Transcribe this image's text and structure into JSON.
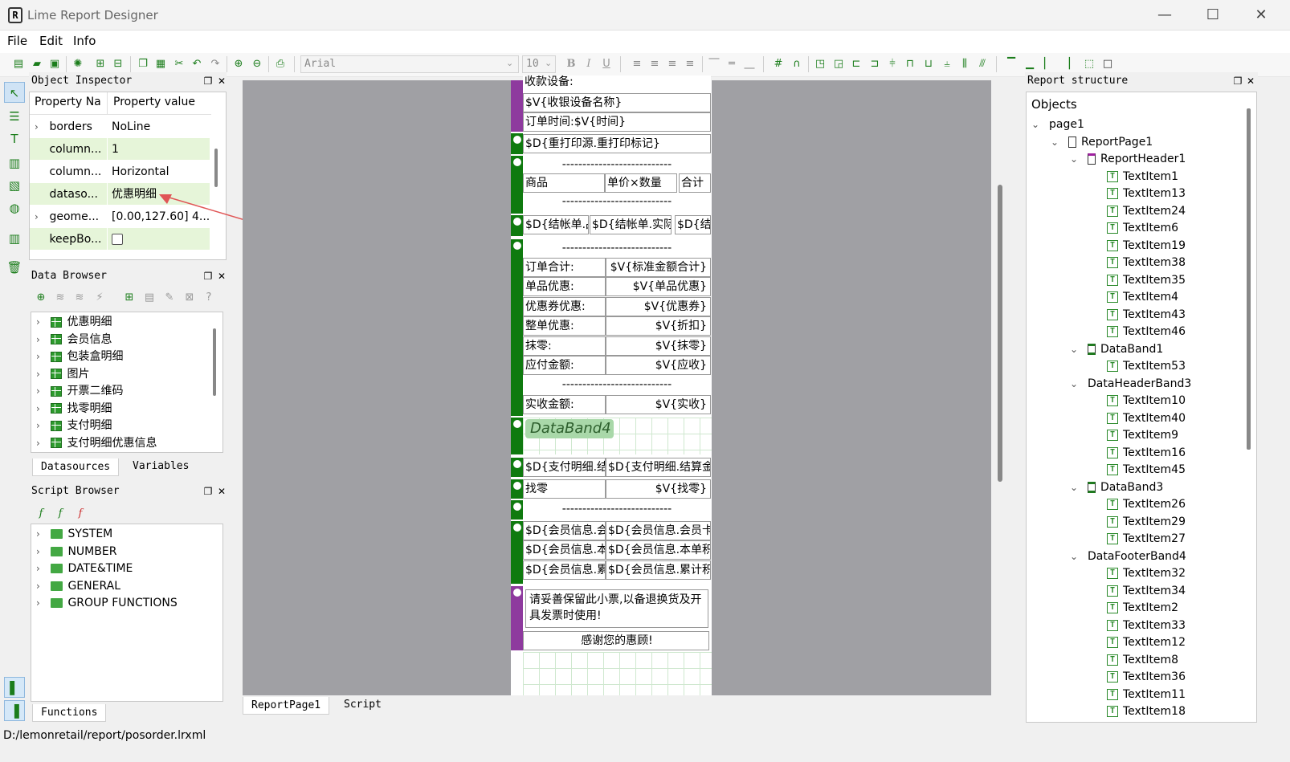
{
  "window": {
    "title": "Lime Report Designer",
    "minimize": "—",
    "maximize": "☐",
    "close": "✕"
  },
  "menu": [
    "File",
    "Edit",
    "Info"
  ],
  "toolbar": {
    "font_name": "Arial",
    "font_size": "10"
  },
  "object_inspector": {
    "title": "Object Inspector",
    "col_name": "Property Na",
    "col_value": "Property value",
    "rows": [
      {
        "name": "borders",
        "value": "NoLine",
        "expand": true,
        "hl": false
      },
      {
        "name": "column...",
        "value": "1",
        "expand": false,
        "hl": true
      },
      {
        "name": "column...",
        "value": "Horizontal",
        "expand": false,
        "hl": false
      },
      {
        "name": "dataso...",
        "value": "优惠明细",
        "expand": false,
        "hl": true
      },
      {
        "name": "geome...",
        "value": "[0.00,127.60] 4...",
        "expand": true,
        "hl": false
      },
      {
        "name": "keepBo...",
        "value": "",
        "expand": false,
        "hl": true,
        "checkbox": true
      }
    ]
  },
  "data_browser": {
    "title": "Data Browser",
    "items": [
      "优惠明细",
      "会员信息",
      "包装盒明细",
      "图片",
      "开票二维码",
      "找零明细",
      "支付明细",
      "支付明细优惠信息"
    ],
    "tabs": [
      "Datasources",
      "Variables"
    ]
  },
  "script_browser": {
    "title": "Script Browser",
    "items": [
      "SYSTEM",
      "NUMBER",
      "DATE&TIME",
      "GENERAL",
      "GROUP FUNCTIONS"
    ],
    "tabs": [
      "Functions"
    ]
  },
  "canvas": {
    "tabs": [
      "ReportPage1",
      "Script"
    ],
    "texts": {
      "t0": "收款设备:",
      "t1": "$V{收银设备名称}",
      "t2": "订单时间:$V{时间}",
      "t3": "$D{重打印源.重打印标记}",
      "t4": "---------------------------",
      "t5": "商品",
      "t6": "单价×数量",
      "t7": "合计",
      "t8": "---------------------------",
      "t9": "$D{结帐单.品名}",
      "t10": "$D{结帐单.实际单价}×",
      "t11": "$D{结帐",
      "t12": "---------------------------",
      "t13": "订单合计:",
      "t14": "$V{标准金额合计}",
      "t15": "单品优惠:",
      "t16": "$V{单品优惠}",
      "t17": "优惠券优惠:",
      "t18": "$V{优惠券}",
      "t19": "整单优惠:",
      "t20": "$V{折扣}",
      "t21": "抹零:",
      "t22": "$V{抹零}",
      "t23": "应付金额:",
      "t24": "$V{应收}",
      "t25": "---------------------------",
      "t26": "实收金额:",
      "t27": "$V{实收}",
      "t28": "DataBand4",
      "t29": "$D{支付明细.结算方",
      "t30": "$D{支付明细.结算金额",
      "t31": "找零",
      "t32": "$V{找零}",
      "t33": "---------------------------",
      "t34": "$D{会员信息.会员卡号",
      "t35": "$D{会员信息.会员卡号",
      "t36": "$D{会员信息.本单积分",
      "t37": "$D{会员信息.本单积分",
      "t38": "$D{会员信息.累计积分",
      "t39": "$D{会员信息.累计积分",
      "t40": "请妥善保留此小票,以备退换货及开具发票时使用!",
      "t41": "感谢您的惠顾!"
    }
  },
  "report_structure": {
    "title": "Report structure",
    "root": "Objects",
    "nodes": [
      {
        "label": "page1",
        "level": 0,
        "kind": "none",
        "chev": "v"
      },
      {
        "label": "ReportPage1",
        "level": 1,
        "kind": "page",
        "chev": "v"
      },
      {
        "label": "ReportHeader1",
        "level": 2,
        "kind": "header",
        "chev": "v"
      },
      {
        "label": "TextItem1",
        "level": 3,
        "kind": "text"
      },
      {
        "label": "TextItem13",
        "level": 3,
        "kind": "text"
      },
      {
        "label": "TextItem24",
        "level": 3,
        "kind": "text"
      },
      {
        "label": "TextItem6",
        "level": 3,
        "kind": "text"
      },
      {
        "label": "TextItem19",
        "level": 3,
        "kind": "text"
      },
      {
        "label": "TextItem38",
        "level": 3,
        "kind": "text"
      },
      {
        "label": "TextItem35",
        "level": 3,
        "kind": "text"
      },
      {
        "label": "TextItem4",
        "level": 3,
        "kind": "text"
      },
      {
        "label": "TextItem43",
        "level": 3,
        "kind": "text"
      },
      {
        "label": "TextItem46",
        "level": 3,
        "kind": "text"
      },
      {
        "label": "DataBand1",
        "level": 2,
        "kind": "band",
        "chev": "v"
      },
      {
        "label": "TextItem53",
        "level": 3,
        "kind": "text"
      },
      {
        "label": "DataHeaderBand3",
        "level": 2,
        "kind": "none",
        "chev": "v"
      },
      {
        "label": "TextItem10",
        "level": 3,
        "kind": "text"
      },
      {
        "label": "TextItem40",
        "level": 3,
        "kind": "text"
      },
      {
        "label": "TextItem9",
        "level": 3,
        "kind": "text"
      },
      {
        "label": "TextItem16",
        "level": 3,
        "kind": "text"
      },
      {
        "label": "TextItem45",
        "level": 3,
        "kind": "text"
      },
      {
        "label": "DataBand3",
        "level": 2,
        "kind": "band",
        "chev": "v"
      },
      {
        "label": "TextItem26",
        "level": 3,
        "kind": "text"
      },
      {
        "label": "TextItem29",
        "level": 3,
        "kind": "text"
      },
      {
        "label": "TextItem27",
        "level": 3,
        "kind": "text"
      },
      {
        "label": "DataFooterBand4",
        "level": 2,
        "kind": "none",
        "chev": "v"
      },
      {
        "label": "TextItem32",
        "level": 3,
        "kind": "text"
      },
      {
        "label": "TextItem34",
        "level": 3,
        "kind": "text"
      },
      {
        "label": "TextItem2",
        "level": 3,
        "kind": "text"
      },
      {
        "label": "TextItem33",
        "level": 3,
        "kind": "text"
      },
      {
        "label": "TextItem12",
        "level": 3,
        "kind": "text"
      },
      {
        "label": "TextItem8",
        "level": 3,
        "kind": "text"
      },
      {
        "label": "TextItem36",
        "level": 3,
        "kind": "text"
      },
      {
        "label": "TextItem11",
        "level": 3,
        "kind": "text"
      },
      {
        "label": "TextItem18",
        "level": 3,
        "kind": "text"
      }
    ]
  },
  "status": {
    "path": "D:/lemonretail/report/posorder.lrxml"
  },
  "colors": {
    "accent_green": "#1b7d1b",
    "band_purple": "#8e3a9e",
    "band_green": "#0f7a0f",
    "highlight": "#e6f5d9"
  }
}
